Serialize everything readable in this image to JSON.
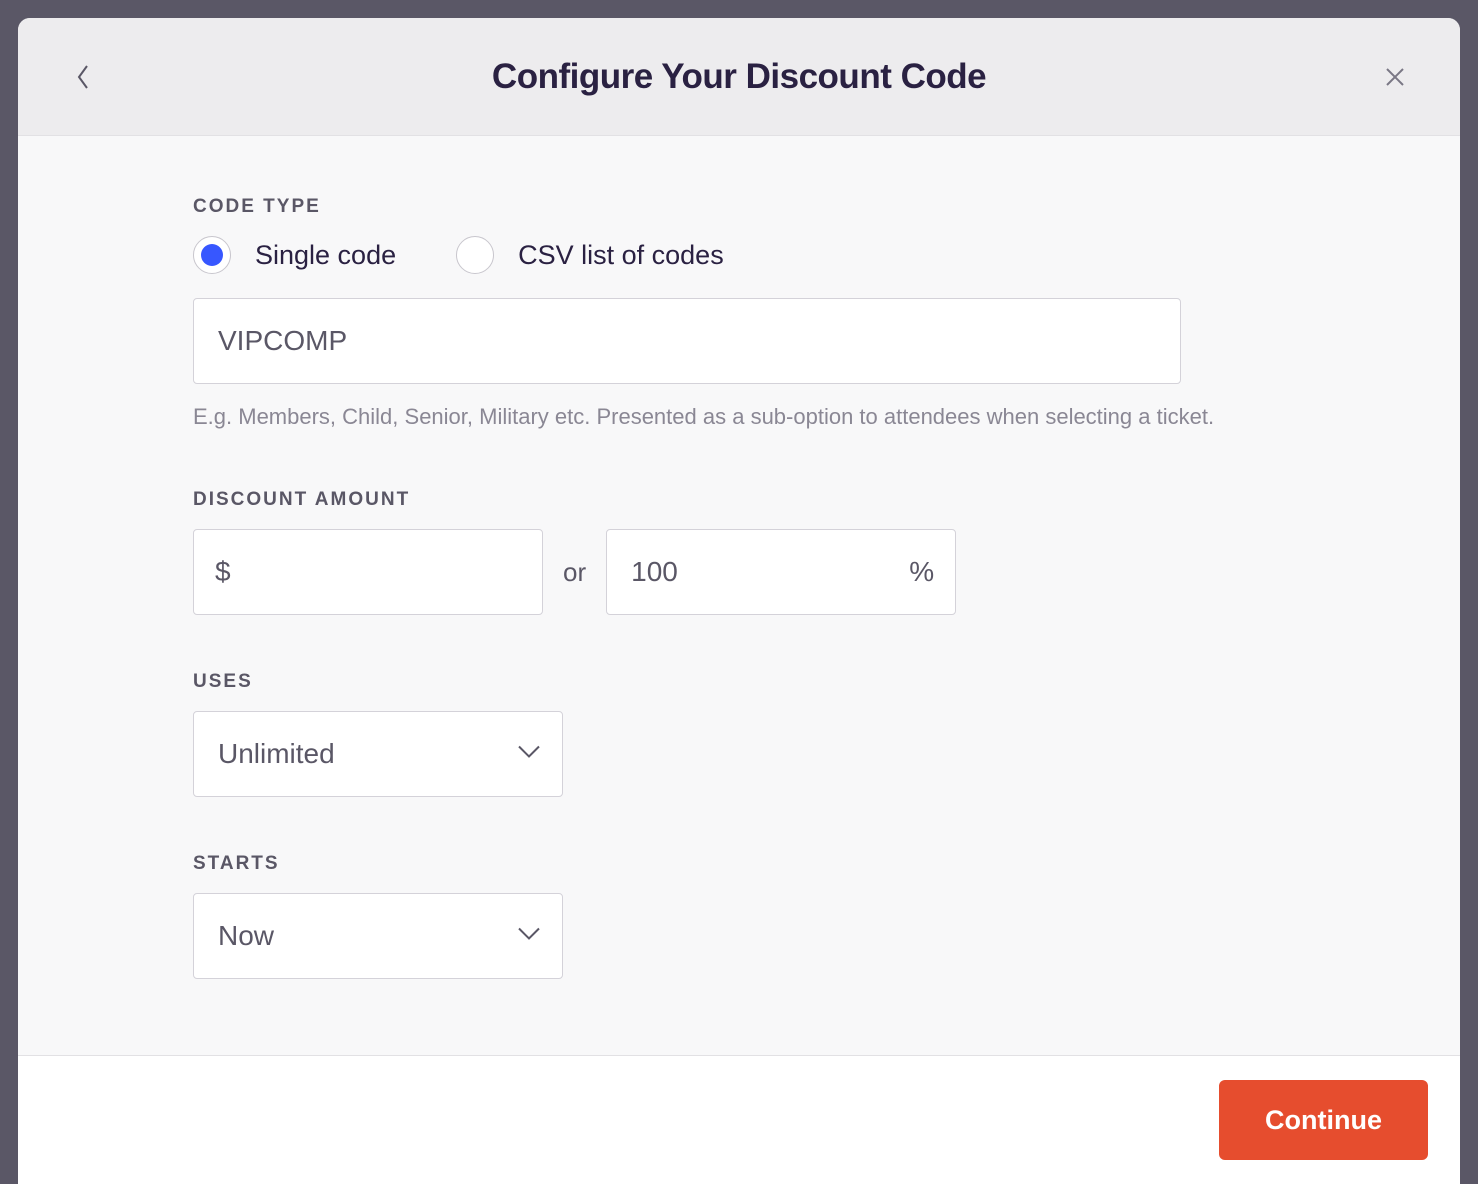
{
  "modal": {
    "title": "Configure Your Discount Code"
  },
  "codeType": {
    "label": "CODE TYPE",
    "options": {
      "single": "Single code",
      "csv": "CSV list of codes"
    },
    "value": "VIPCOMP",
    "helper": "E.g. Members, Child, Senior, Military etc. Presented as a sub-option to attendees when selecting a ticket."
  },
  "discountAmount": {
    "label": "DISCOUNT AMOUNT",
    "currencySymbol": "$",
    "dollarValue": "",
    "orText": "or",
    "percentValue": "100",
    "percentSymbol": "%"
  },
  "uses": {
    "label": "USES",
    "value": "Unlimited"
  },
  "starts": {
    "label": "STARTS",
    "value": "Now"
  },
  "footer": {
    "continueLabel": "Continue"
  }
}
